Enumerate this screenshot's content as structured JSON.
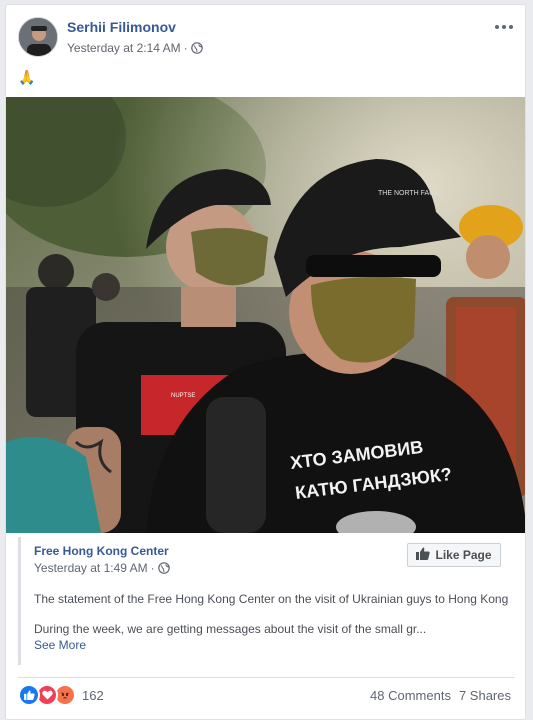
{
  "post": {
    "author": "Serhii Filimonov",
    "timestamp": "Yesterday at 2:14 AM",
    "separator": "·",
    "privacy_icon": "globe-icon",
    "more_icon": "ellipsis-icon",
    "text": "🙏"
  },
  "photo": {
    "shirt_text_line1": "ХТО ЗАМОВИВ",
    "shirt_text_line2": "КАТЮ ГАНДЗЮК?"
  },
  "shared": {
    "page_name": "Free Hong Kong Center",
    "timestamp": "Yesterday at 1:49 AM",
    "separator": "·",
    "like_page_label": "Like Page",
    "statement": "The statement of the Free Hong Kong Center on the visit of Ukrainian guys to Hong Kong",
    "excerpt": "During the week, we are getting messages about the visit of the small gr...",
    "see_more": "See More"
  },
  "footer": {
    "reaction_icons": [
      "like",
      "love",
      "angry"
    ],
    "reaction_count": "162",
    "comments": "48 Comments",
    "shares": "7 Shares"
  },
  "colors": {
    "link": "#385898",
    "like_blue": "#1877f2",
    "love_red": "#f33e58",
    "angry_orange": "#f7714c"
  }
}
